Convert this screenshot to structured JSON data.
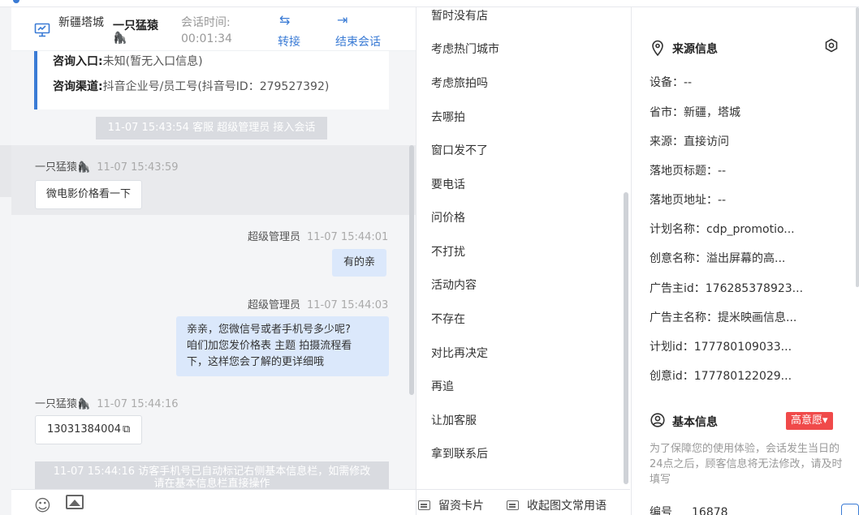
{
  "header": {
    "location": "新疆塔城",
    "visitor_name": "一只猛猿",
    "visitor_emoji": "🦍",
    "session_label": "会话时间:",
    "session_time": "00:01:34",
    "transfer_label": "转接",
    "end_label": "结束会话"
  },
  "inquiry": {
    "entry_label": "咨询入口:",
    "entry_value": "未知(暂无入口信息)",
    "channel_label": "咨询渠道:",
    "channel_value": "抖音企业号/员工号(抖音号ID：279527392)"
  },
  "messages": {
    "sys_1": "11-07 15:43:54 客服 超级管理员 接入会话",
    "m1_name": "一只猛猿🦍",
    "m1_time": "11-07 15:43:59",
    "m1_text": "微电影价格看一下",
    "m2_name": "超级管理员",
    "m2_time": "11-07 15:44:01",
    "m2_text": "有的亲",
    "m3_name": "超级管理员",
    "m3_time": "11-07 15:44:03",
    "m3_line1": "亲亲，您微信号或者手机号多少呢?",
    "m3_line2": "咱们加您发价格表 主题 拍摄流程看",
    "m3_line3": "下，这样您会了解的更详细哦",
    "m4_name": "一只猛猿🦍",
    "m4_time": "11-07 15:44:16",
    "m4_text": "13031384004",
    "sys_2_line1": "11-07 15:44:16 访客手机号已自动标记右侧基本信息栏，如需修改",
    "sys_2_line2": "请在基本信息栏直接操作"
  },
  "phrases": {
    "items": [
      "暂时没有店",
      "考虑热门城市",
      "考虑旅拍吗",
      "去哪拍",
      "窗口发不了",
      "要电话",
      "问价格",
      "不打扰",
      "活动内容",
      "不存在",
      "对比再决定",
      "再追",
      "让加客服",
      "拿到联系后"
    ],
    "footer_card": "留资卡片",
    "footer_collapse": "收起图文常用语"
  },
  "source_info": {
    "title": "来源信息",
    "rows": [
      "设备：--",
      "省市：新疆，塔城",
      "来源：直接访问",
      "落地页标题：--",
      "落地页地址：--",
      "计划名称：cdp_promotio...",
      "创意名称：溢出屏幕的高...",
      "广告主id：176285378923...",
      "广告主名称：提米映画信息...",
      "计划id：177780109033...",
      "创意id：177780122029..."
    ]
  },
  "basic_info": {
    "title": "基本信息",
    "intent_badge": "高意愿▾",
    "notice": "为了保障您的使用体验，会话发生当日的24点之后，顾客信息将无法修改，请及时填写",
    "id_label": "编号",
    "id_value": "16878"
  },
  "colors": {
    "accent": "#3a7bd5",
    "badge_red": "#f04a4a",
    "bubble_out": "#dbe8fb"
  }
}
